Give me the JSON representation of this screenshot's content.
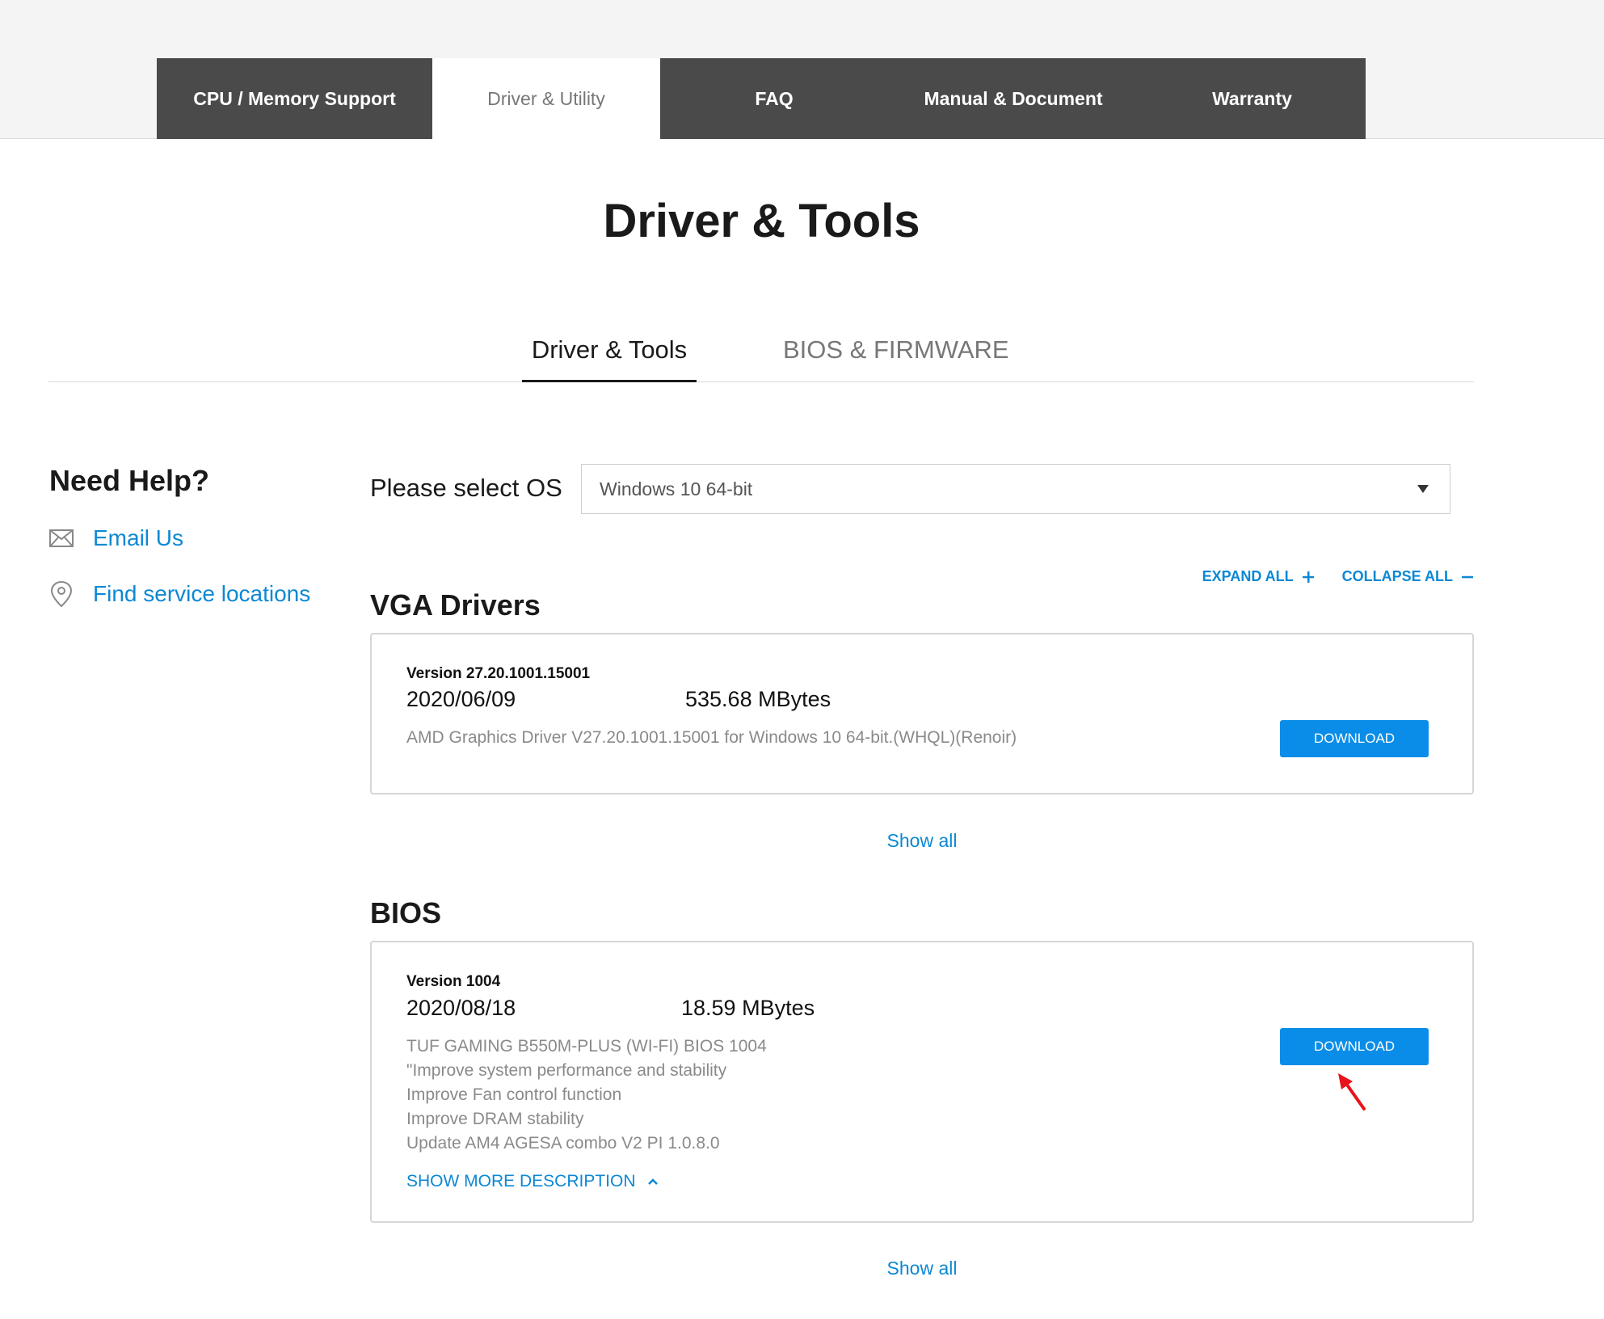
{
  "support_nav": {
    "tabs": [
      {
        "label": "CPU / Memory Support",
        "active": false
      },
      {
        "label": "Driver & Utility",
        "active": true
      },
      {
        "label": "FAQ",
        "active": false
      },
      {
        "label": "Manual & Document",
        "active": false
      },
      {
        "label": "Warranty",
        "active": false
      }
    ]
  },
  "page_title": "Driver & Tools",
  "sub_tabs": [
    {
      "label": "Driver & Tools",
      "active": true
    },
    {
      "label": "BIOS & FIRMWARE",
      "active": false
    }
  ],
  "help": {
    "title": "Need Help?",
    "email_label": "Email Us",
    "locations_label": "Find service locations"
  },
  "os": {
    "label": "Please select OS",
    "selected": "Windows 10 64-bit"
  },
  "controls": {
    "expand_all": "EXPAND ALL",
    "collapse_all": "COLLAPSE ALL"
  },
  "sections": {
    "vga": {
      "title": "VGA Drivers",
      "version": "Version 27.20.1001.15001",
      "date": "2020/06/09",
      "size": "535.68 MBytes",
      "description": "AMD Graphics Driver V27.20.1001.15001 for Windows 10 64-bit.(WHQL)(Renoir)",
      "download_label": "DOWNLOAD",
      "show_all": "Show all"
    },
    "bios": {
      "title": "BIOS",
      "version": "Version 1004",
      "date": "2020/08/18",
      "size": "18.59 MBytes",
      "description_lines": [
        "TUF GAMING B550M-PLUS (WI-FI) BIOS 1004",
        "\"Improve system performance and stability",
        "Improve Fan control function",
        "Improve DRAM stability",
        "Update AM4 AGESA combo V2 PI 1.0.8.0"
      ],
      "show_more_label": "SHOW MORE DESCRIPTION",
      "download_label": "DOWNLOAD",
      "show_all": "Show all"
    }
  },
  "colors": {
    "nav_bg": "#4a4a4a",
    "accent_blue": "#0c88d4",
    "button_blue": "#0a8de8",
    "annotation_red": "#e8141c"
  },
  "icons": {
    "email": "envelope-icon",
    "location": "map-pin-icon",
    "os_dropdown": "caret-down-icon",
    "expand": "plus-icon",
    "collapse": "minus-icon",
    "show_more": "chevron-up-icon",
    "annotation": "red-arrow-icon"
  }
}
